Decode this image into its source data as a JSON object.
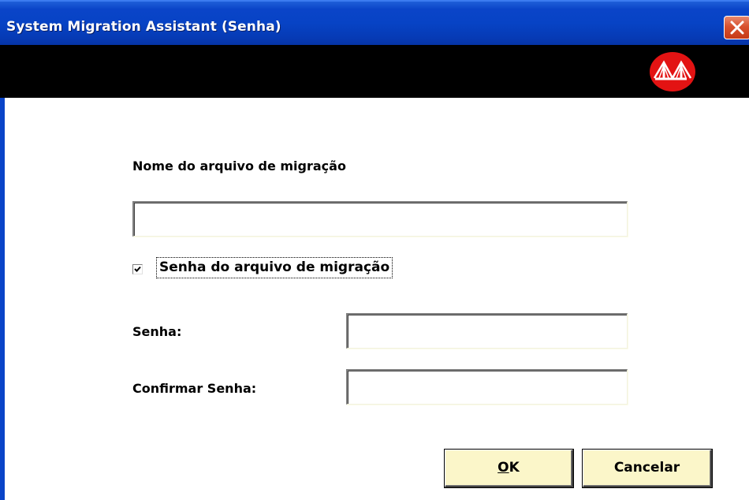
{
  "window": {
    "title": "System Migration Assistant (Senha)",
    "logo_icon": "sma-bridge-logo-icon",
    "close_icon": "close-icon",
    "accent_color": "#0a44c8",
    "close_color": "#d8512e",
    "banner_color": "#000000",
    "logo_color": "#e31313"
  },
  "form": {
    "filename_label": "Nome do arquivo de migração",
    "filename_value": "",
    "password_checkbox_label": "Senha do arquivo de migração",
    "password_checkbox_checked": true,
    "password_label": "Senha:",
    "password_value": "",
    "confirm_label": "Confirmar Senha:",
    "confirm_value": ""
  },
  "buttons": {
    "ok_mnemonic": "O",
    "ok_rest": "K",
    "cancel_label": "Cancelar",
    "button_color": "#fbf6c9"
  }
}
